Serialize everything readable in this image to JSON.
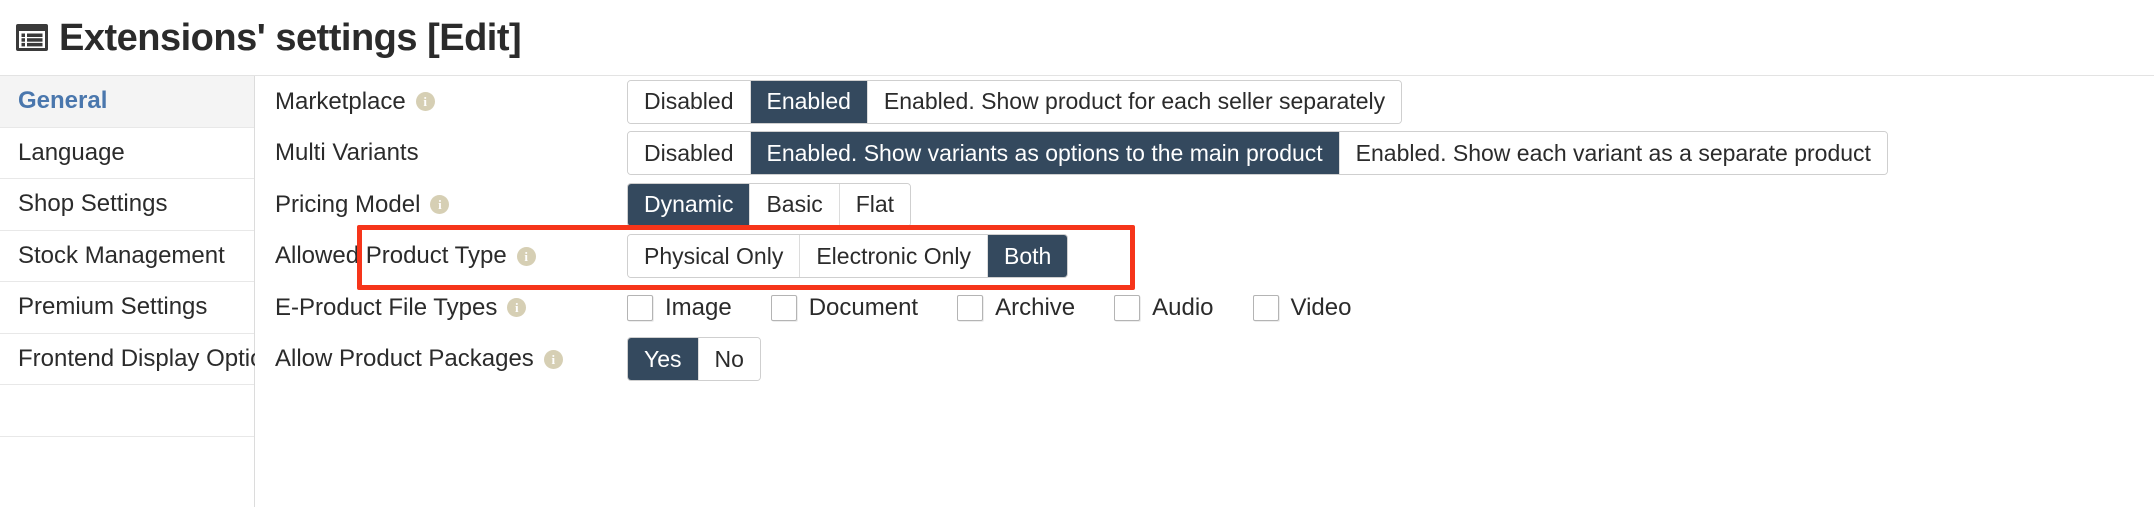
{
  "header": {
    "icon": "list-table-icon",
    "title": "Extensions' settings [Edit]"
  },
  "sidebar": {
    "items": [
      {
        "label": "General",
        "active": true
      },
      {
        "label": "Language",
        "active": false
      },
      {
        "label": "Shop Settings",
        "active": false
      },
      {
        "label": "Stock Management",
        "active": false
      },
      {
        "label": "Premium Settings",
        "active": false
      },
      {
        "label": "Frontend Display Options",
        "active": false
      },
      {
        "label": "",
        "active": false
      }
    ]
  },
  "form": {
    "rows": [
      {
        "label": "Marketplace",
        "has_info": true,
        "type": "buttons",
        "options": [
          {
            "label": "Disabled",
            "selected": false
          },
          {
            "label": "Enabled",
            "selected": true
          },
          {
            "label": "Enabled. Show product for each seller separately",
            "selected": false
          }
        ]
      },
      {
        "label": "Multi Variants",
        "has_info": false,
        "type": "buttons",
        "options": [
          {
            "label": "Disabled",
            "selected": false
          },
          {
            "label": "Enabled. Show variants as options to the main product",
            "selected": true
          },
          {
            "label": "Enabled. Show each variant as a separate product",
            "selected": false
          }
        ]
      },
      {
        "label": "Pricing Model",
        "has_info": true,
        "type": "buttons",
        "highlighted": true,
        "options": [
          {
            "label": "Dynamic",
            "selected": true
          },
          {
            "label": "Basic",
            "selected": false
          },
          {
            "label": "Flat",
            "selected": false
          }
        ]
      },
      {
        "label": "Allowed Product Type",
        "has_info": true,
        "type": "buttons",
        "options": [
          {
            "label": "Physical Only",
            "selected": false
          },
          {
            "label": "Electronic Only",
            "selected": false
          },
          {
            "label": "Both",
            "selected": true
          }
        ]
      },
      {
        "label": "E-Product File Types",
        "has_info": true,
        "type": "checkboxes",
        "options": [
          {
            "label": "Image",
            "checked": false
          },
          {
            "label": "Document",
            "checked": false
          },
          {
            "label": "Archive",
            "checked": false
          },
          {
            "label": "Audio",
            "checked": false
          },
          {
            "label": "Video",
            "checked": false
          }
        ]
      },
      {
        "label": "Allow Product Packages",
        "has_info": true,
        "type": "buttons",
        "options": [
          {
            "label": "Yes",
            "selected": true
          },
          {
            "label": "No",
            "selected": false
          }
        ]
      }
    ]
  },
  "annotation": {
    "color": "#f6351a",
    "target_row": "Pricing Model"
  },
  "colors": {
    "selected_button": "#34495e",
    "active_sidebar_text": "#4a77ad",
    "info_icon": "#d6cfb4",
    "highlight": "#f6351a"
  }
}
